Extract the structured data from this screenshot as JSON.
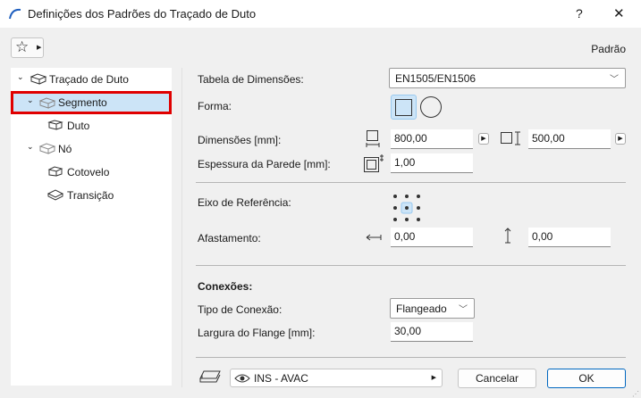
{
  "window": {
    "title": "Definições dos Padrões do Traçado de Duto",
    "help": "?",
    "close": "✕"
  },
  "toolbar": {
    "preset_label": "Padrão"
  },
  "tree": [
    {
      "label": "Traçado de Duto",
      "expanded": true
    },
    {
      "label": "Segmento",
      "expanded": true,
      "selected": true
    },
    {
      "label": "Duto"
    },
    {
      "label": "Nó",
      "expanded": true
    },
    {
      "label": "Cotovelo"
    },
    {
      "label": "Transição"
    }
  ],
  "form": {
    "table_label": "Tabela de Dimensões:",
    "table_value": "EN1505/EN1506",
    "shape_label": "Forma:",
    "dims_label": "Dimensões [mm]:",
    "width_value": "800,00",
    "height_value": "500,00",
    "wall_label": "Espessura da Parede [mm]:",
    "wall_value": "1,00",
    "axis_label": "Eixo de Referência:",
    "offset_label": "Afastamento:",
    "offset_h": "0,00",
    "offset_v": "0,00",
    "connections_title": "Conexões:",
    "conn_type_label": "Tipo de Conexão:",
    "conn_type_value": "Flangeado",
    "flange_label": "Largura do Flange [mm]:",
    "flange_value": "30,00"
  },
  "footer": {
    "layer_value": "INS - AVAC",
    "cancel": "Cancelar",
    "ok": "OK"
  },
  "colors": {
    "selection": "#cce4f7",
    "highlight_border": "#e00000",
    "ok_border": "#0067c0"
  }
}
